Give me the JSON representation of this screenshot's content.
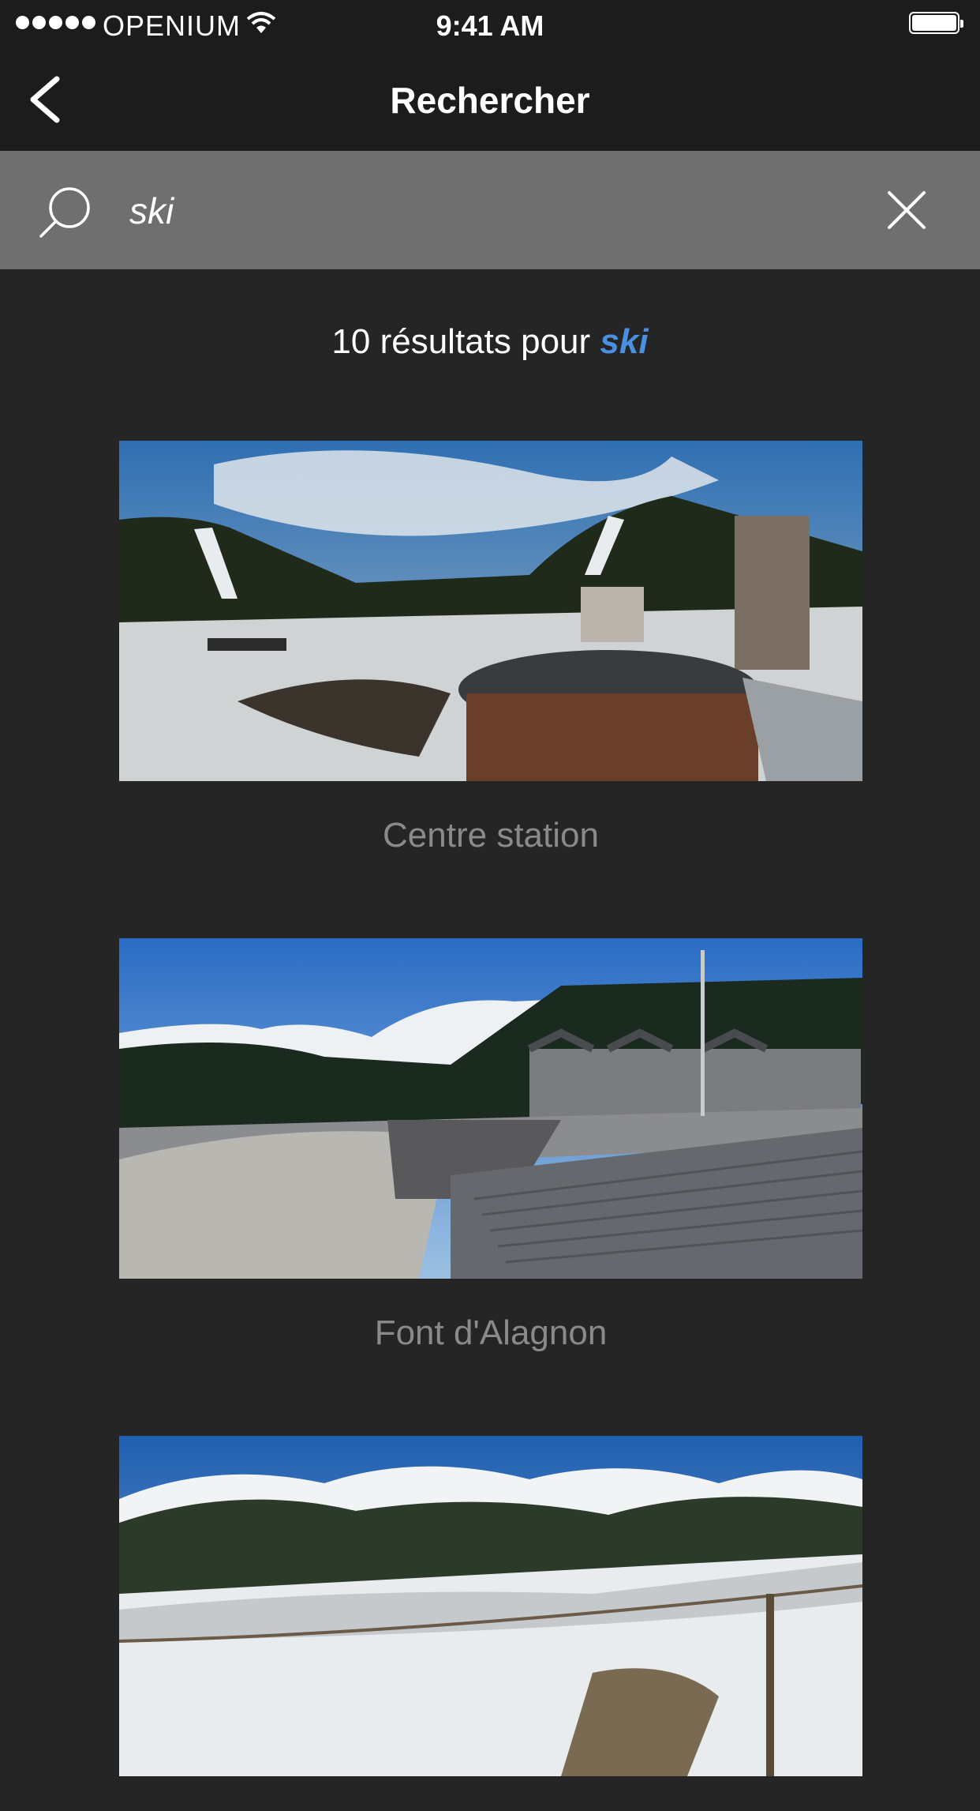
{
  "status_bar": {
    "carrier": "OPENIUM",
    "time": "9:41 AM",
    "signal_icon": "signal-dots-icon",
    "wifi_icon": "wifi-icon",
    "battery_icon": "battery-full-icon"
  },
  "nav": {
    "title": "Rechercher",
    "back_icon": "chevron-left-icon"
  },
  "search": {
    "value": "ski",
    "icon": "search-icon",
    "clear_icon": "close-icon"
  },
  "results": {
    "count_text": "10 résultats pour ",
    "term": "ski",
    "term_color": "#4a8fe0",
    "items": [
      {
        "caption": "Centre station"
      },
      {
        "caption": "Font d'Alagnon"
      },
      {
        "caption": ""
      }
    ]
  }
}
